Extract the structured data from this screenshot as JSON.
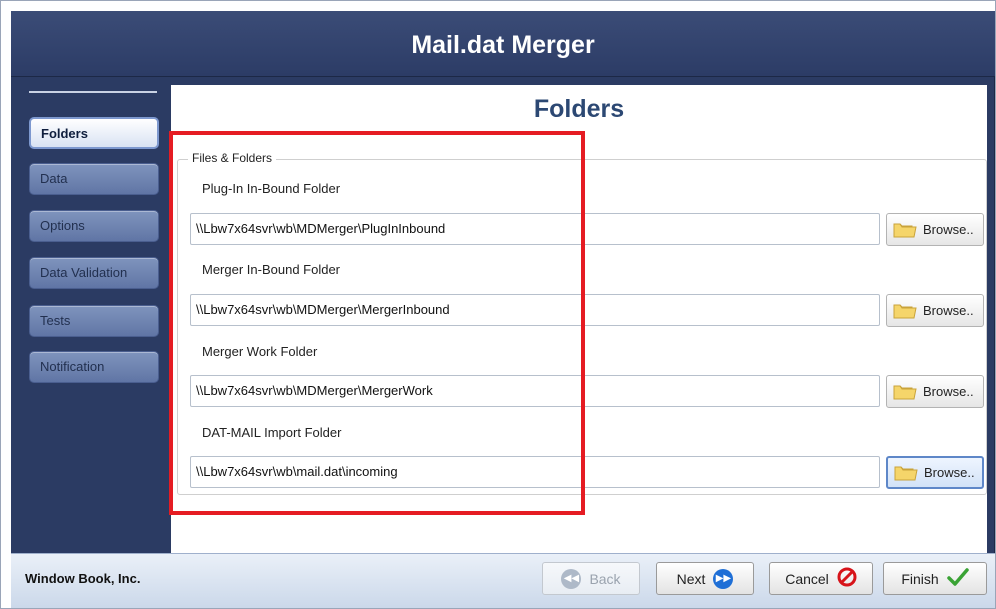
{
  "app": {
    "title": "Mail.dat Merger"
  },
  "sidebar": {
    "items": [
      {
        "label": "Folders",
        "active": true
      },
      {
        "label": "Data"
      },
      {
        "label": "Options"
      },
      {
        "label": "Data Validation"
      },
      {
        "label": "Tests"
      },
      {
        "label": "Notification"
      }
    ]
  },
  "page": {
    "title": "Folders"
  },
  "group": {
    "legend": "Files & Folders",
    "fields": [
      {
        "label": "Plug-In In-Bound Folder",
        "value": "\\\\Lbw7x64svr\\wb\\MDMerger\\PlugInInbound",
        "browse_label": "Browse.."
      },
      {
        "label": "Merger In-Bound Folder",
        "value": "\\\\Lbw7x64svr\\wb\\MDMerger\\MergerInbound",
        "browse_label": "Browse.."
      },
      {
        "label": "Merger Work Folder",
        "value": "\\\\Lbw7x64svr\\wb\\MDMerger\\MergerWork",
        "browse_label": "Browse.."
      },
      {
        "label": "DAT-MAIL Import Folder",
        "value": "\\\\Lbw7x64svr\\wb\\mail.dat\\incoming",
        "browse_label": "Browse.."
      }
    ]
  },
  "footer": {
    "company": "Window Book, Inc.",
    "back_label": "Back",
    "next_label": "Next",
    "cancel_label": "Cancel",
    "finish_label": "Finish"
  },
  "icons": {
    "back": "back-arrow-icon",
    "next": "next-arrow-icon",
    "cancel": "cancel-icon",
    "finish": "checkmark-icon",
    "browse": "folder-icon"
  },
  "colors": {
    "frame": "#2b3b63",
    "accent_title": "#2c4873",
    "highlight": "#e51c23",
    "finish_check": "#3aa335",
    "cancel_red": "#d7141a",
    "next_blue": "#1f6fd6"
  }
}
